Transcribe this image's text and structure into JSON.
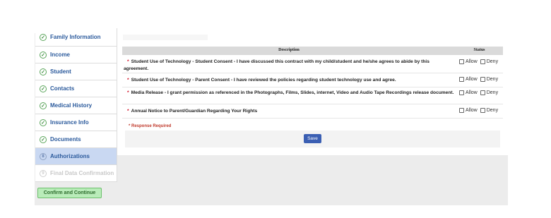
{
  "sidebar": {
    "items": [
      {
        "label": "Family Information",
        "state": "done"
      },
      {
        "label": "Income",
        "state": "done"
      },
      {
        "label": "Student",
        "state": "done"
      },
      {
        "label": "Contacts",
        "state": "done"
      },
      {
        "label": "Medical History",
        "state": "done"
      },
      {
        "label": "Insurance Info",
        "state": "done"
      },
      {
        "label": "Documents",
        "state": "done"
      },
      {
        "label": "Authorizations",
        "state": "active",
        "number": "8"
      },
      {
        "label": "Final Data Confirmation",
        "state": "disabled",
        "number": "9"
      }
    ],
    "confirm_label": "Confirm and Continue"
  },
  "table": {
    "header_description": "Description",
    "header_status": "Status",
    "rows": [
      {
        "bullet": "*",
        "text": "Student Use of Technology - Student Consent - I have discussed this contract with my child/student and he/she agrees to abide by this agreement."
      },
      {
        "bullet": "*",
        "text": "Student Use of Technology - Parent Consent - I have reviewed the policies regarding student technology use and agree."
      },
      {
        "bullet": "*",
        "text": "Media Release - I grant permission as referenced in the Photographs, Films, Slides, internet, Video and Audio Tape Recordings release document."
      },
      {
        "bullet": "*",
        "text": "Annual Notice to Parent/Guardian Regarding Your Rights"
      }
    ],
    "allow_label": "Allow",
    "deny_label": "Deny"
  },
  "required_note": "* Response Required",
  "save_label": "Save",
  "colors": {
    "link": "#2b5a9c",
    "active_bg": "#c9d8f2",
    "save_button": "#3b5fb3",
    "confirm_button": "#b9ecb9",
    "required": "#c0392b"
  },
  "icons": {
    "done": "check-circle-icon",
    "step": "step-number-icon"
  }
}
